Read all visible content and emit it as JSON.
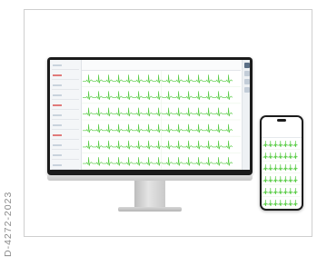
{
  "document_code": "D-4272-2023",
  "colors": {
    "ecg_trace": "#4fc93a",
    "ecg_grid": "#e9f5e6",
    "alert": "#e07a7a",
    "accent": "#5b6f86"
  },
  "monitor": {
    "top_bar_fields": [
      "",
      "",
      ""
    ]
  },
  "phone": {
    "title": "",
    "subtitle": ""
  }
}
